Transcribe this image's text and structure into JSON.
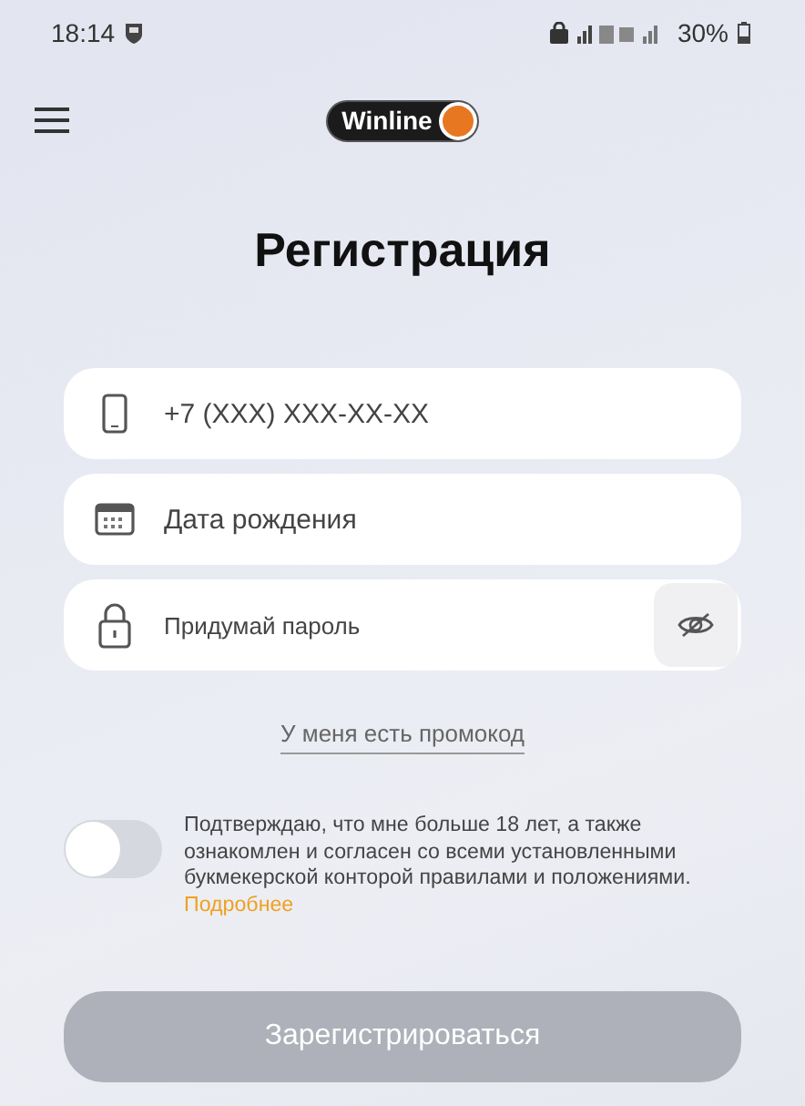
{
  "status_bar": {
    "time": "18:14",
    "battery": "30%"
  },
  "header": {
    "logo": "Winline"
  },
  "title": "Регистрация",
  "fields": [
    {
      "kind": "phone",
      "placeholder": "+7 (XXX) XXX-XX-XX"
    },
    {
      "kind": "date",
      "placeholder": "Дата рождения"
    },
    {
      "kind": "password",
      "placeholder": "Придумай пароль"
    }
  ],
  "promo_link": "У меня есть промокод",
  "consent": {
    "on": false,
    "text": "Подтверждаю, что мне больше 18 лет, а также ознакомлен и согласен со всеми установленными букмекерской конторой правилами и положениями.",
    "link": "Подробнее"
  },
  "submit": {
    "label": "Зарегистрироваться",
    "disabled": true
  }
}
